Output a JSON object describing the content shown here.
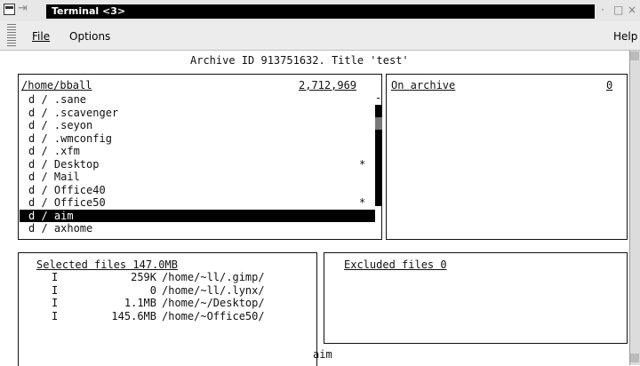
{
  "window": {
    "title": "Terminal <3>",
    "pin_glyph": "⇥",
    "minimize_glyph": "·",
    "maximize_glyph": "□",
    "close_glyph": "×"
  },
  "menu": {
    "file": "File",
    "options": "Options",
    "help": "Help"
  },
  "header": {
    "archive_line": "Archive ID 913751632. Title 'test'"
  },
  "left_panel": {
    "path": "/home/bball",
    "size": "2,712,969",
    "rows": [
      {
        "text": "d / .sane",
        "mark": ""
      },
      {
        "text": "d / .scavenger",
        "mark": ""
      },
      {
        "text": "d / .seyon",
        "mark": ""
      },
      {
        "text": "d / .wmconfig",
        "mark": ""
      },
      {
        "text": "d / .xfm",
        "mark": ""
      },
      {
        "text": "d / Desktop",
        "mark": "*"
      },
      {
        "text": "d / Mail",
        "mark": ""
      },
      {
        "text": "d / Office40",
        "mark": ""
      },
      {
        "text": "d / Office50",
        "mark": "*"
      },
      {
        "text": "d / aim",
        "mark": "",
        "selected": true
      },
      {
        "text": "d / axhome",
        "mark": ""
      }
    ],
    "scroll_marker": "-"
  },
  "right_panel": {
    "label": "On archive",
    "count": "0"
  },
  "selected_panel": {
    "label": "Selected files 147.0MB",
    "rows": [
      {
        "flag": "I",
        "size": "259K",
        "path": "/home/~ll/.gimp/"
      },
      {
        "flag": "I",
        "size": "0",
        "path": "/home/~ll/.lynx/"
      },
      {
        "flag": "I",
        "size": "1.1MB",
        "path": "/home/~/Desktop/"
      },
      {
        "flag": "I",
        "size": "145.6MB",
        "path": "/home/~Office50/"
      }
    ]
  },
  "excluded_panel": {
    "label": "Excluded files 0"
  },
  "status": {
    "current": "aim"
  },
  "colors": {
    "background": "#ffffff",
    "titlebar": "#e7e7e7",
    "title_active": "#000000",
    "selection": "#000000"
  }
}
